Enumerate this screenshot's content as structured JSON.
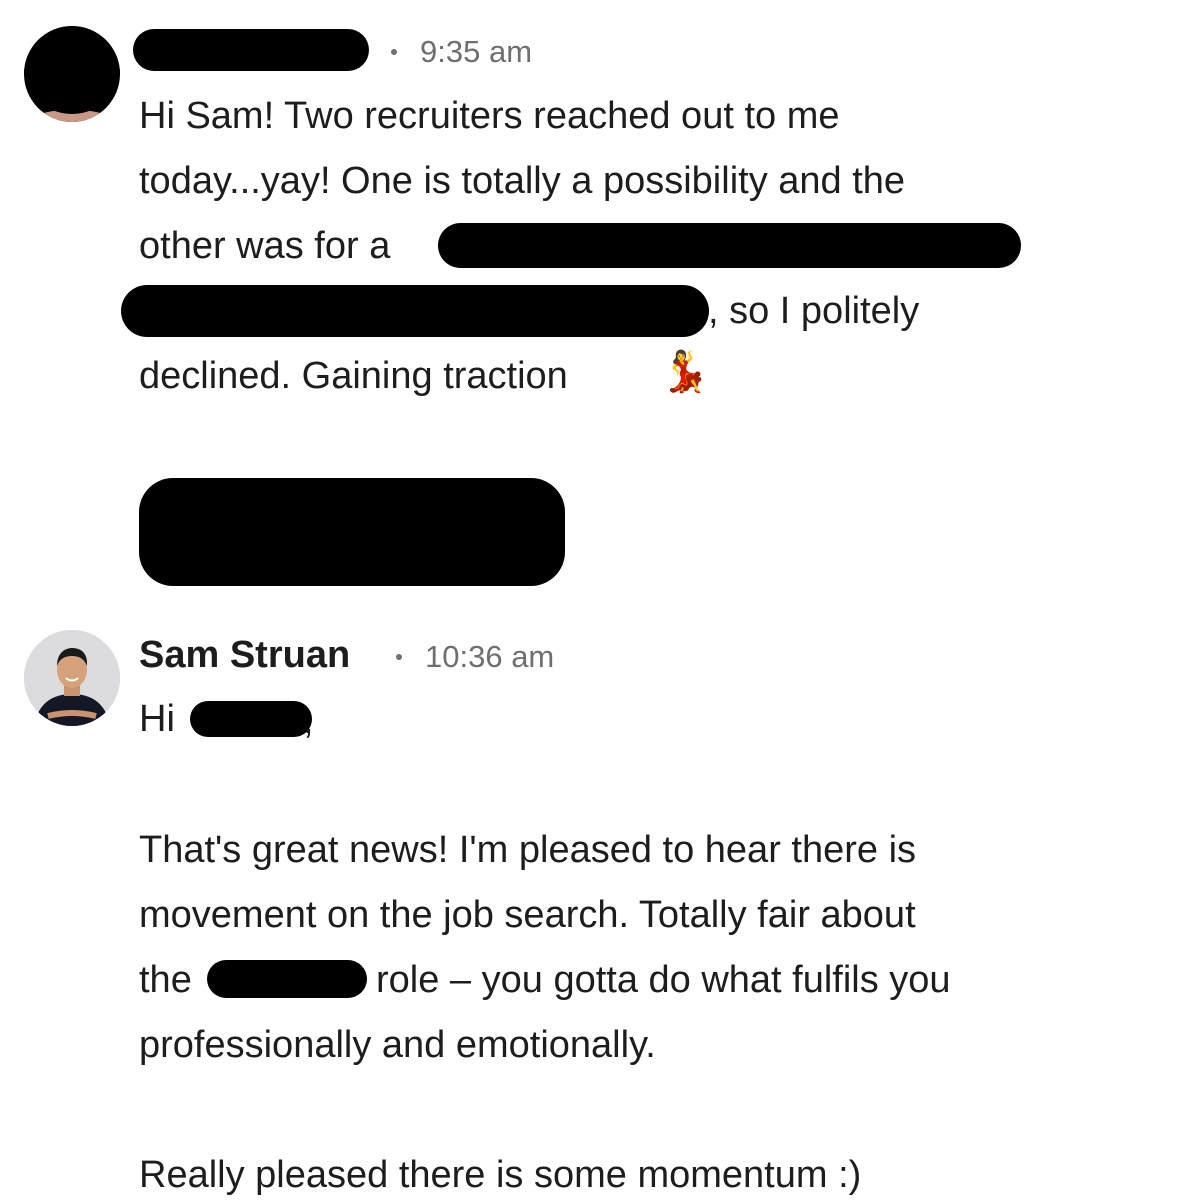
{
  "message1": {
    "sender_avatar": "redacted-avatar",
    "sender_name": "",
    "time": "9:35 am",
    "lines": [
      "Hi Sam!  Two recruiters reached out to me",
      "today...yay!  One is totally a possibility and the",
      "other was for a",
      ", so I politely",
      "declined.  Gaining traction"
    ],
    "emoji": "💃"
  },
  "message2": {
    "sender_avatar": "person-photo",
    "sender_name": "Sam Struan",
    "time": "10:36 am",
    "greeting": "Hi",
    "greeting_suffix": ",",
    "lines": [
      "That's great news! I'm pleased to hear there is",
      "movement on the job search. Totally fair about",
      "the",
      "role – you gotta do what fulfils you",
      "professionally and emotionally.",
      "Really pleased there is some momentum :)"
    ]
  },
  "colors": {
    "text": "#1d1d1f",
    "meta": "#6e6e73",
    "redaction": "#000000"
  }
}
